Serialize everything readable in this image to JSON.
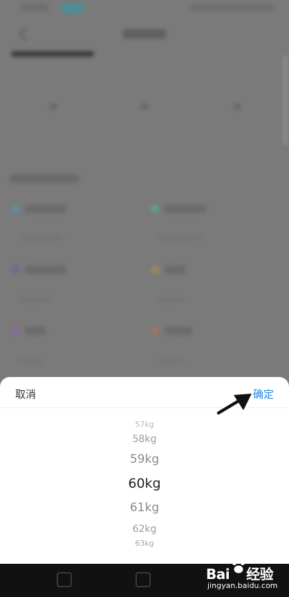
{
  "sheet": {
    "cancel_label": "取消",
    "confirm_label": "确定"
  },
  "picker": {
    "options": [
      "57kg",
      "58kg",
      "59kg",
      "60kg",
      "61kg",
      "62kg",
      "63kg"
    ],
    "selected": "60kg"
  },
  "watermark": {
    "brand": "Bai",
    "brand_suffix": "经验",
    "site": "jingyan.baidu.com"
  },
  "colors": {
    "accent": "#1e88e5",
    "overlay": "#7a7a7a",
    "navbar": "#111111"
  }
}
